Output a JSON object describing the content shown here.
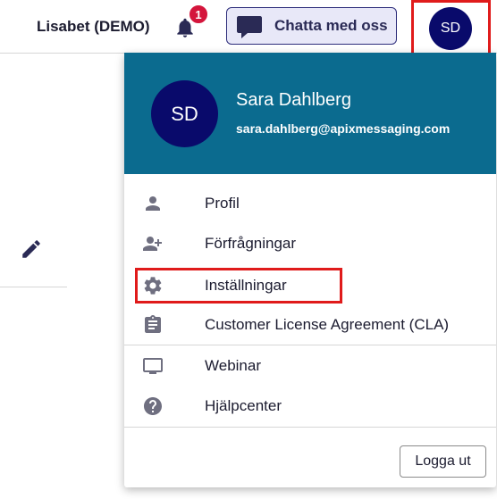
{
  "header": {
    "org_name": "Lisabet (DEMO)",
    "notification_count": "1",
    "chat_button_label": "Chatta med oss",
    "avatar_initials": "SD"
  },
  "user_menu": {
    "avatar_initials": "SD",
    "name": "Sara Dahlberg",
    "email": "sara.dahlberg@apixmessaging.com",
    "items": [
      {
        "label": "Profil",
        "icon": "person-icon"
      },
      {
        "label": "Förfrågningar",
        "icon": "person-add-icon"
      },
      {
        "label": "Inställningar",
        "icon": "gear-icon"
      },
      {
        "label": "Customer License Agreement (CLA)",
        "icon": "clipboard-icon"
      },
      {
        "label": "Webinar",
        "icon": "monitor-icon"
      },
      {
        "label": "Hjälpcenter",
        "icon": "help-icon"
      }
    ],
    "logout_label": "Logga ut"
  },
  "colors": {
    "header_teal": "#0b6b8f",
    "avatar_navy": "#090a6b",
    "badge_red": "#d4153c",
    "highlight_red": "#e01b1b",
    "icon_grey": "#6f6f80"
  }
}
